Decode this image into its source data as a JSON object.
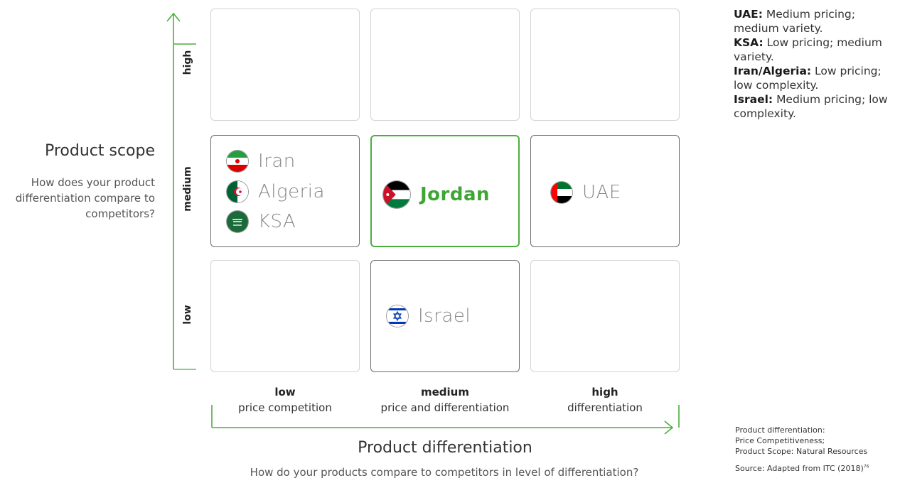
{
  "y_axis": {
    "title": "Product scope",
    "question": "How does your product differentiation compare to competitors?",
    "ticks": [
      "high",
      "medium",
      "low"
    ]
  },
  "x_axis": {
    "title": "Product differentiation",
    "question": "How do your products compare to competitors in level of differentiation?",
    "columns": [
      {
        "level": "low",
        "desc": "price competition"
      },
      {
        "level": "medium",
        "desc": "price and differentiation"
      },
      {
        "level": "high",
        "desc": "differentiation"
      }
    ]
  },
  "grid": {
    "medium_low": [
      "Iran",
      "Algeria",
      "KSA"
    ],
    "medium_medium": [
      "Jordan"
    ],
    "medium_high": [
      "UAE"
    ],
    "low_medium": [
      "Israel"
    ]
  },
  "notes": [
    {
      "country": "UAE:",
      "text": "Medium pricing; medium variety."
    },
    {
      "country": "KSA:",
      "text": "Low pricing; medium variety."
    },
    {
      "country": "Iran/Algeria:",
      "text": "Low pricing; low complexity."
    },
    {
      "country": "Israel:",
      "text": "Medium pricing; low complexity."
    }
  ],
  "meta_lines": [
    "Product differentiation:",
    "Price Competitiveness;",
    "Product Scope: Natural Resources"
  ],
  "source": {
    "text": "Source: Adapted from ITC (2018)",
    "ref": "76"
  },
  "colors": {
    "accent": "#4cae3f",
    "dark_border": "#6b6b6b",
    "light_border": "#d3d3d3"
  },
  "icons": {
    "iran": "iran-flag-icon",
    "algeria": "algeria-flag-icon",
    "ksa": "saudi-flag-icon",
    "jordan": "jordan-flag-icon",
    "uae": "uae-flag-icon",
    "israel": "israel-flag-icon"
  }
}
